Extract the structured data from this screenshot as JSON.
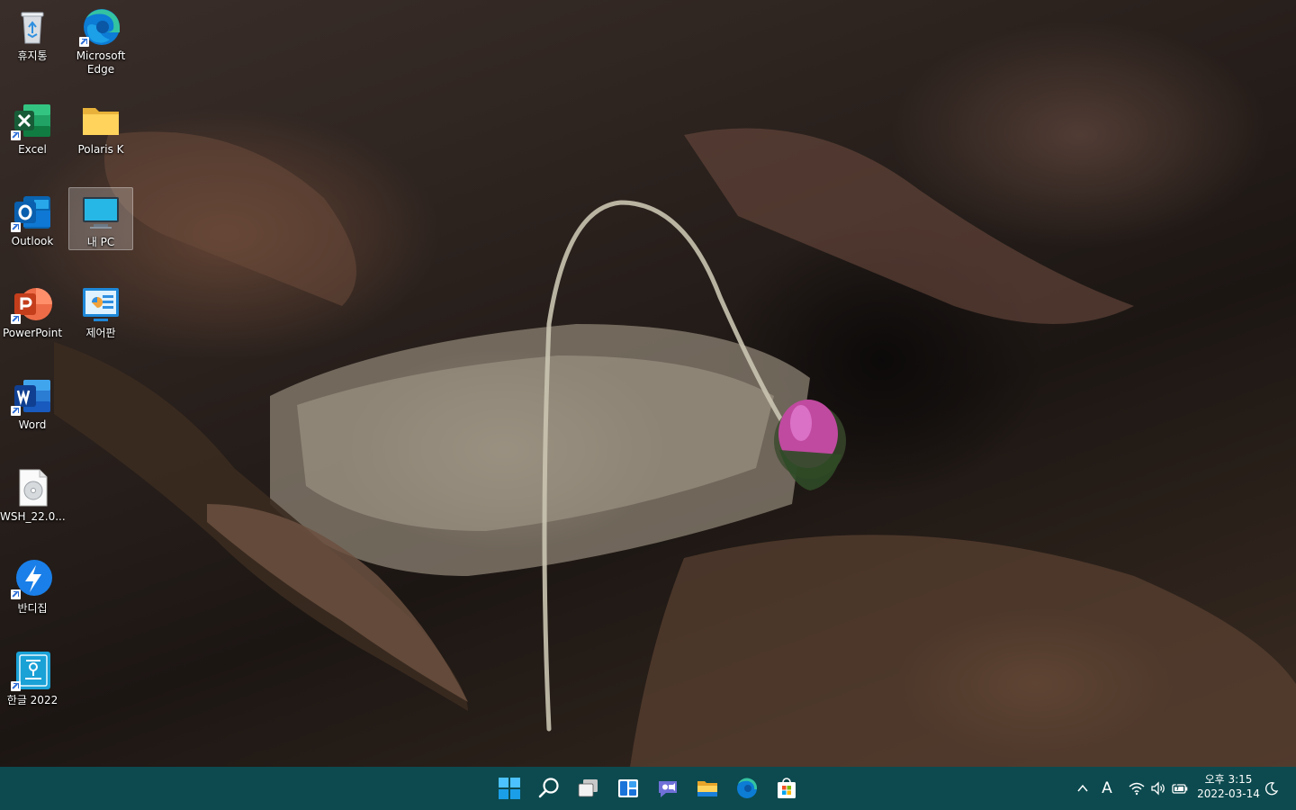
{
  "desktop": {
    "icons": [
      {
        "label": "휴지통",
        "icon": "recycle-bin-icon"
      },
      {
        "label": "Microsoft Edge",
        "icon": "edge-icon"
      },
      {
        "label": "Excel",
        "icon": "excel-icon"
      },
      {
        "label": "Polaris K",
        "icon": "folder-icon"
      },
      {
        "label": "Outlook",
        "icon": "outlook-icon"
      },
      {
        "label": "내 PC",
        "icon": "monitor-icon"
      },
      {
        "label": "PowerPoint",
        "icon": "powerpoint-icon"
      },
      {
        "label": "제어판",
        "icon": "control-panel-icon"
      },
      {
        "label": "Word",
        "icon": "word-icon"
      },
      {
        "label": "WSH_22.0...",
        "icon": "disc-image-file-icon"
      },
      {
        "label": "반디집",
        "icon": "bandizip-icon"
      },
      {
        "label": "한글 2022",
        "icon": "hangul-icon"
      }
    ]
  },
  "taskbar": {
    "pinned": [
      "start-icon",
      "search-icon",
      "task-view-icon",
      "widgets-icon",
      "chat-icon",
      "file-explorer-icon",
      "edge-icon",
      "store-icon"
    ],
    "tray": {
      "ime_indicator": "A",
      "time": "오후 3:15",
      "date": "2022-03-14"
    }
  },
  "colors": {
    "taskbar": "#0c4a4f",
    "accent": "#0078d4"
  }
}
